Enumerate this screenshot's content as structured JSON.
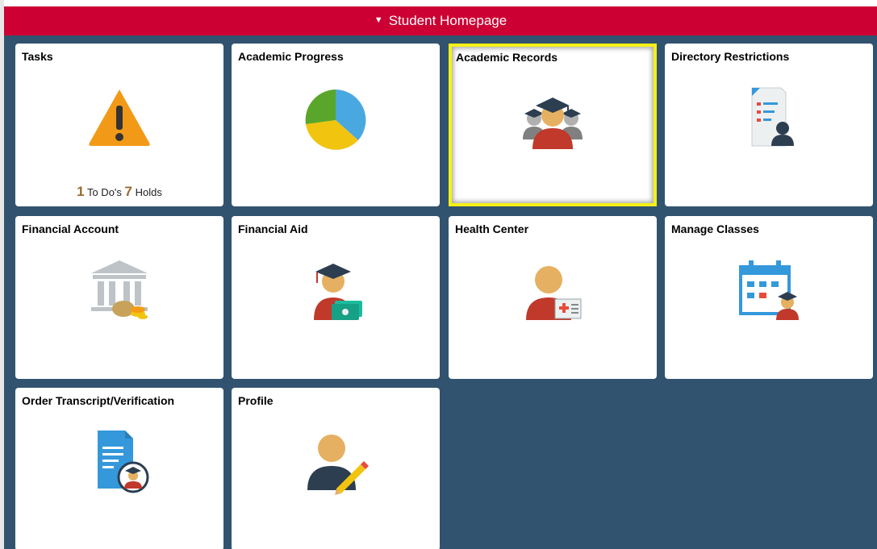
{
  "header": {
    "title": "Student Homepage",
    "caret_icon": "triangle-down"
  },
  "tiles": [
    {
      "title": "Tasks",
      "icon": "warning-triangle-icon",
      "todo_count": "1",
      "todo_label": "To Do's",
      "holds_count": "7",
      "holds_label": "Holds"
    },
    {
      "title": "Academic Progress",
      "icon": "pie-chart-icon"
    },
    {
      "title": "Academic Records",
      "icon": "graduates-icon",
      "selected": true
    },
    {
      "title": "Directory Restrictions",
      "icon": "document-person-icon"
    },
    {
      "title": "Financial Account",
      "icon": "bank-coins-icon"
    },
    {
      "title": "Financial Aid",
      "icon": "graduate-money-icon"
    },
    {
      "title": "Health Center",
      "icon": "person-medical-card-icon"
    },
    {
      "title": "Manage Classes",
      "icon": "calendar-graduate-icon"
    },
    {
      "title": "Order Transcript/Verification",
      "icon": "document-graduate-icon"
    },
    {
      "title": "Profile",
      "icon": "person-pencil-icon"
    }
  ],
  "colors": {
    "header_bg": "#cc0033",
    "board_bg": "#32536f",
    "selected_outline": "#f5f016",
    "count_color": "#9a6a2f"
  }
}
